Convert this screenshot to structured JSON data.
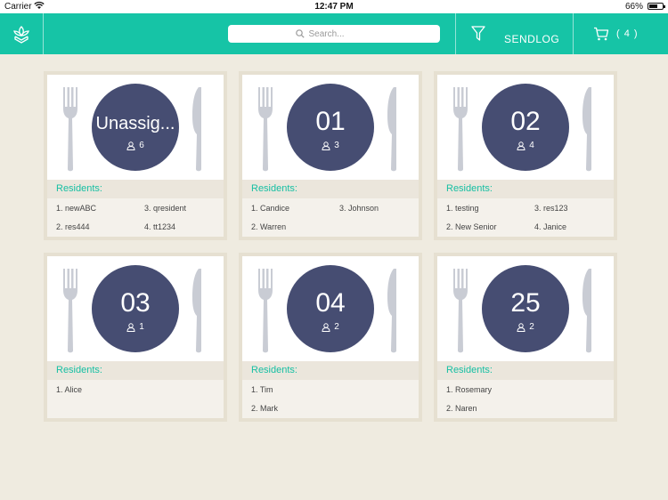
{
  "status_bar": {
    "carrier": "Carrier",
    "time": "12:47 PM",
    "battery_percent": "66%",
    "battery_level": 0.66
  },
  "nav": {
    "logo_icon": "plant-leaf-icon",
    "search_placeholder": "Search...",
    "filter_icon": "filter-funnel-icon",
    "sendlog_label": "SENDLOG",
    "cart_icon": "cart-icon",
    "cart_count": "( 4 )"
  },
  "colors": {
    "accent_teal": "#16c4a6",
    "plate_navy": "#464d72",
    "background": "#efebe0",
    "residents_label": "#16bfa3",
    "utensil_gray": "#c9ccd4"
  },
  "tables": [
    {
      "name": "Unassig...",
      "count": "6",
      "residents_label": "Residents:",
      "residents": [
        "1. newABC",
        "2. res444",
        "3. qresident",
        "4. tt1234"
      ]
    },
    {
      "name": "01",
      "count": "3",
      "residents_label": "Residents:",
      "residents": [
        "1. Candice",
        "2. Warren",
        "3. Johnson"
      ]
    },
    {
      "name": "02",
      "count": "4",
      "residents_label": "Residents:",
      "residents": [
        "1. testing",
        "2. New Senior",
        "3. res123",
        "4. Janice"
      ]
    },
    {
      "name": "03",
      "count": "1",
      "residents_label": "Residents:",
      "residents": [
        "1. Alice"
      ]
    },
    {
      "name": "04",
      "count": "2",
      "residents_label": "Residents:",
      "residents": [
        "1. Tim",
        "2. Mark"
      ]
    },
    {
      "name": "25",
      "count": "2",
      "residents_label": "Residents:",
      "residents": [
        "1. Rosemary",
        "2. Naren"
      ]
    }
  ]
}
